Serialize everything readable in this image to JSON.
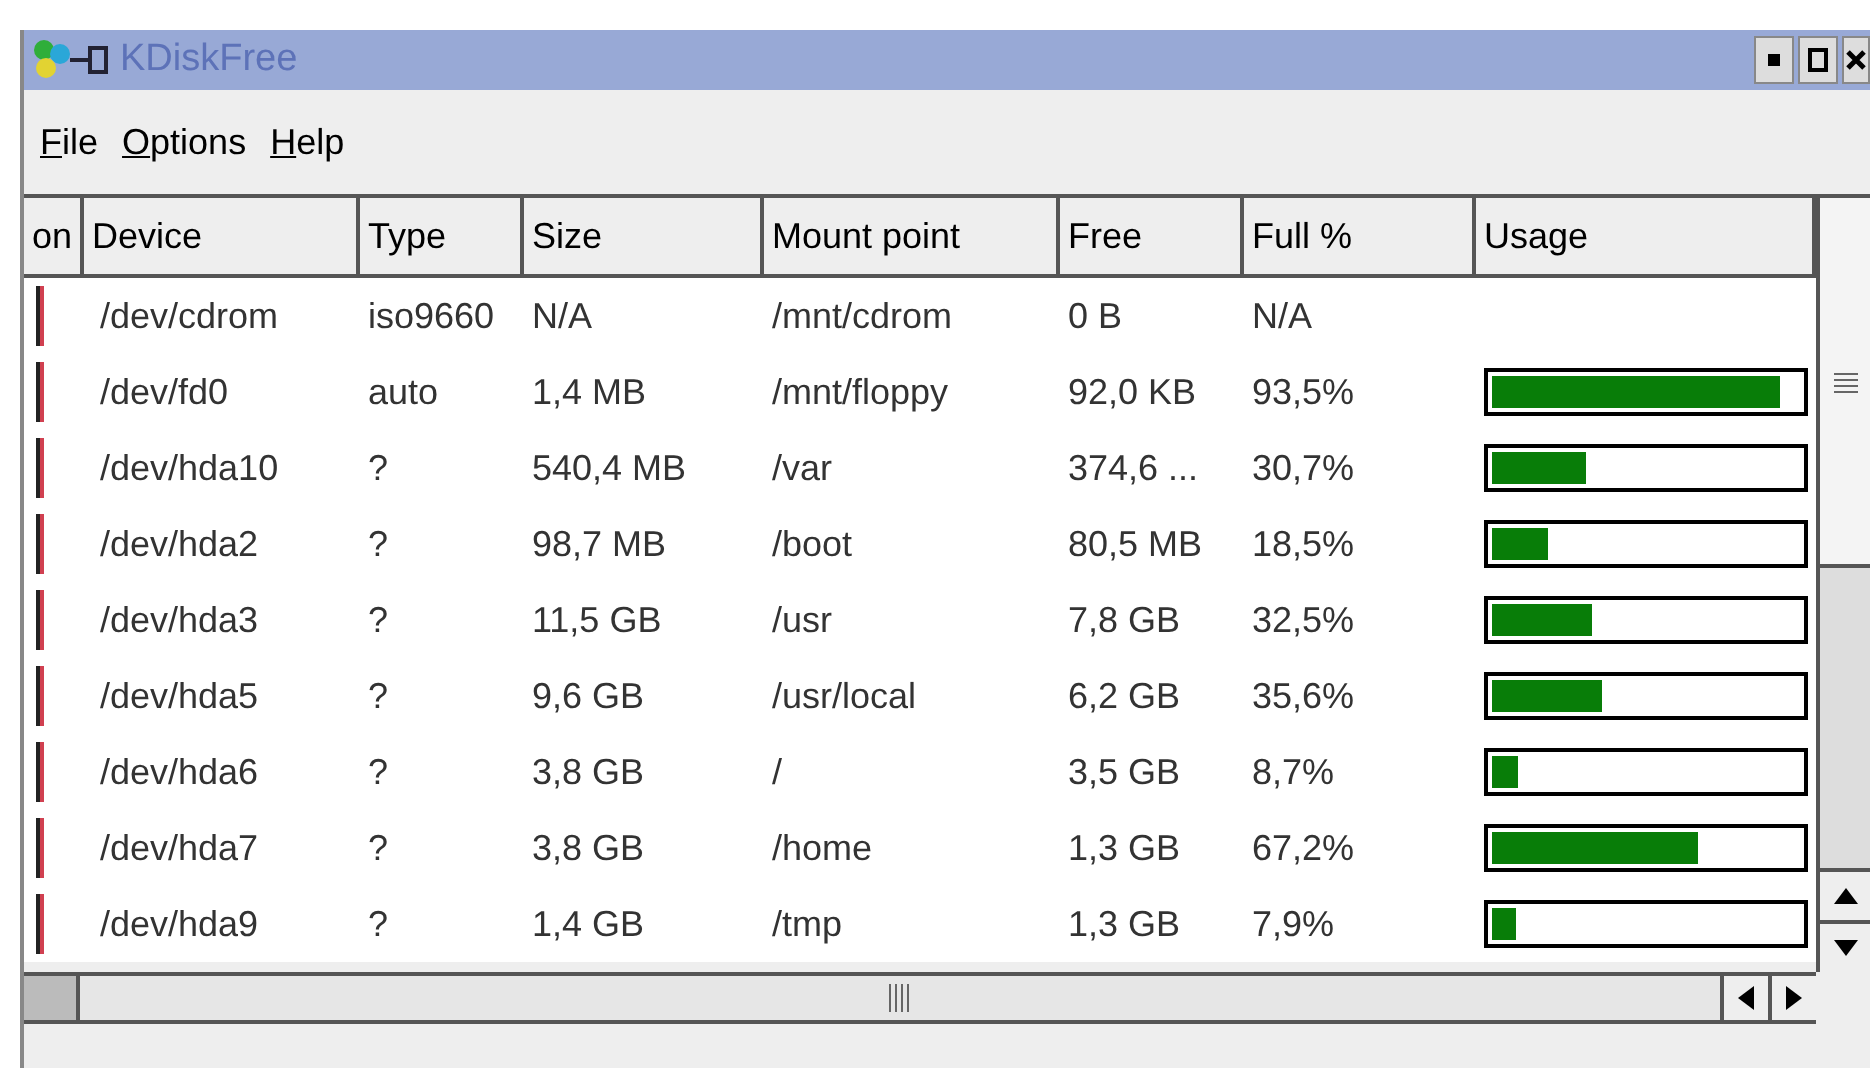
{
  "window": {
    "title": "KDiskFree"
  },
  "menu": [
    "File",
    "Options",
    "Help"
  ],
  "table": {
    "columns": [
      "on",
      "Device",
      "Type",
      "Size",
      "Mount point",
      "Free",
      "Full %",
      "Usage"
    ],
    "rows": [
      {
        "device": "/dev/cdrom",
        "type": "iso9660",
        "size": "N/A",
        "mount": "/mnt/cdrom",
        "free": "0 B",
        "full": "N/A"
      },
      {
        "device": "/dev/fd0",
        "type": "auto",
        "size": "1,4 MB",
        "mount": "/mnt/floppy",
        "free": "92,0 KB",
        "full": "93,5%",
        "level": 0.935
      },
      {
        "device": "/dev/hda10",
        "type": "?",
        "size": "540,4 MB",
        "mount": "/var",
        "free": "374,6 ...",
        "full": "30,7%",
        "level": 0.307
      },
      {
        "device": "/dev/hda2",
        "type": "?",
        "size": "98,7 MB",
        "mount": "/boot",
        "free": "80,5 MB",
        "full": "18,5%",
        "level": 0.185
      },
      {
        "device": "/dev/hda3",
        "type": "?",
        "size": "11,5 GB",
        "mount": "/usr",
        "free": "7,8 GB",
        "full": "32,5%",
        "level": 0.325
      },
      {
        "device": "/dev/hda5",
        "type": "?",
        "size": "9,6 GB",
        "mount": "/usr/local",
        "free": "6,2 GB",
        "full": "35,6%",
        "level": 0.356
      },
      {
        "device": "/dev/hda6",
        "type": "?",
        "size": "3,8 GB",
        "mount": "/",
        "free": "3,5 GB",
        "full": "8,7%",
        "level": 0.087
      },
      {
        "device": "/dev/hda7",
        "type": "?",
        "size": "3,8 GB",
        "mount": "/home",
        "free": "1,3 GB",
        "full": "67,2%",
        "level": 0.672
      },
      {
        "device": "/dev/hda9",
        "type": "?",
        "size": "1,4 GB",
        "mount": "/tmp",
        "free": "1,3 GB",
        "full": "7,9%",
        "level": 0.079
      }
    ]
  }
}
